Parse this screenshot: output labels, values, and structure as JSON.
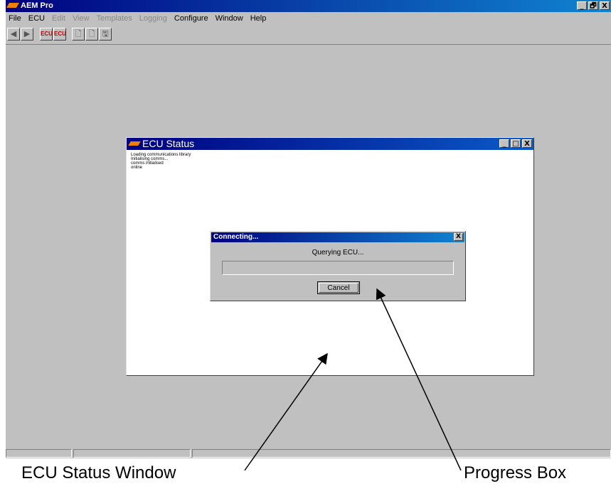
{
  "app": {
    "title": "AEM Pro",
    "window_controls": [
      "_",
      "🗗",
      "X"
    ]
  },
  "menubar": [
    {
      "label": "File",
      "enabled": true
    },
    {
      "label": "ECU",
      "enabled": true
    },
    {
      "label": "Edit",
      "enabled": false
    },
    {
      "label": "View",
      "enabled": false
    },
    {
      "label": "Templates",
      "enabled": false
    },
    {
      "label": "Logging",
      "enabled": false
    },
    {
      "label": "Configure",
      "enabled": true
    },
    {
      "label": "Window",
      "enabled": true
    },
    {
      "label": "Help",
      "enabled": true
    }
  ],
  "toolbar": {
    "icons": [
      "back-icon",
      "forward-icon",
      "ecu-upload-icon",
      "ecu-download-icon",
      "new-file-icon",
      "open-file-icon",
      "save-file-icon"
    ]
  },
  "ecu_status": {
    "title": "ECU Status",
    "controls": [
      "_",
      "□",
      "X"
    ],
    "log": [
      "Loading communications library",
      "Initialising comms...",
      "comms initialised",
      "online"
    ]
  },
  "progress_dialog": {
    "title": "Connecting...",
    "close": "X",
    "message": "Querying ECU...",
    "progress": 0,
    "cancel_label": "Cancel"
  },
  "annotations": {
    "ecu_window": "ECU Status Window",
    "progress_box": "Progress Box"
  },
  "colors": {
    "title_bar": "#000080",
    "workspace": "#c0c0c0",
    "logo": "#f08000"
  }
}
